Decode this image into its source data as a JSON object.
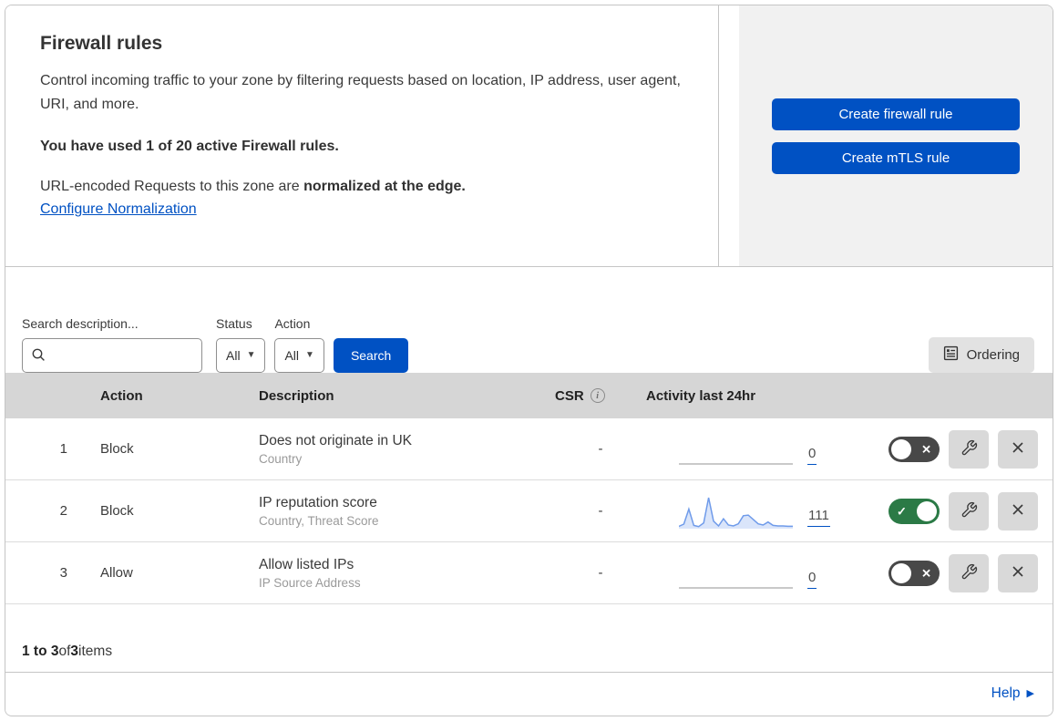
{
  "header": {
    "title": "Firewall rules",
    "description": "Control incoming traffic to your zone by filtering requests based on location, IP address, user agent, URI, and more.",
    "usage_line": "You have used 1 of 20 active Firewall rules.",
    "normalization_text": "URL-encoded Requests to this zone are ",
    "normalization_bold": "normalized at the edge.",
    "normalization_link": "Configure Normalization",
    "create_firewall_button": "Create firewall rule",
    "create_mtls_button": "Create mTLS rule"
  },
  "filters": {
    "search_label": "Search description...",
    "search_value": "",
    "status_label": "Status",
    "status_value": "All",
    "action_label": "Action",
    "action_value": "All",
    "search_button": "Search",
    "ordering_button": "Ordering"
  },
  "table": {
    "columns": {
      "action": "Action",
      "description": "Description",
      "csr": "CSR",
      "activity": "Activity last 24hr"
    },
    "rows": [
      {
        "priority": "1",
        "action": "Block",
        "description": "Does not originate in UK",
        "criteria": "Country",
        "csr": "-",
        "activity_count": "0",
        "enabled": false,
        "activity_values": []
      },
      {
        "priority": "2",
        "action": "Block",
        "description": "IP reputation score",
        "criteria": "Country, Threat Score",
        "csr": "-",
        "activity_count": "111",
        "enabled": true,
        "activity_values": [
          5,
          12,
          62,
          8,
          4,
          16,
          100,
          22,
          6,
          30,
          9,
          6,
          13,
          40,
          42,
          28,
          13,
          9,
          19,
          8,
          6,
          6,
          5,
          5
        ]
      },
      {
        "priority": "3",
        "action": "Allow",
        "description": "Allow listed IPs",
        "criteria": "IP Source Address",
        "csr": "-",
        "activity_count": "0",
        "enabled": false,
        "activity_values": []
      }
    ]
  },
  "chart_data": {
    "type": "area",
    "title": "Activity last 24hr (rule 2)",
    "x": [
      0,
      1,
      2,
      3,
      4,
      5,
      6,
      7,
      8,
      9,
      10,
      11,
      12,
      13,
      14,
      15,
      16,
      17,
      18,
      19,
      20,
      21,
      22,
      23
    ],
    "values": [
      5,
      12,
      62,
      8,
      4,
      16,
      100,
      22,
      6,
      30,
      9,
      6,
      13,
      40,
      42,
      28,
      13,
      9,
      19,
      8,
      6,
      6,
      5,
      5
    ],
    "total": 111,
    "xlabel": "",
    "ylabel": "",
    "ylim": [
      0,
      100
    ],
    "grid": false,
    "legend": "none"
  },
  "footer": {
    "range_bold": "1 to 3",
    "of_text": " of ",
    "total_bold": "3",
    "items_text": " items",
    "help_label": "Help"
  },
  "colors": {
    "primary_blue": "#0051c3",
    "toggle_on_green": "#2b7a46",
    "toggle_off_gray": "#484848",
    "sparkline_blue": "#6f9bea",
    "sparkline_fill": "rgba(158,187,241,0.38)"
  }
}
